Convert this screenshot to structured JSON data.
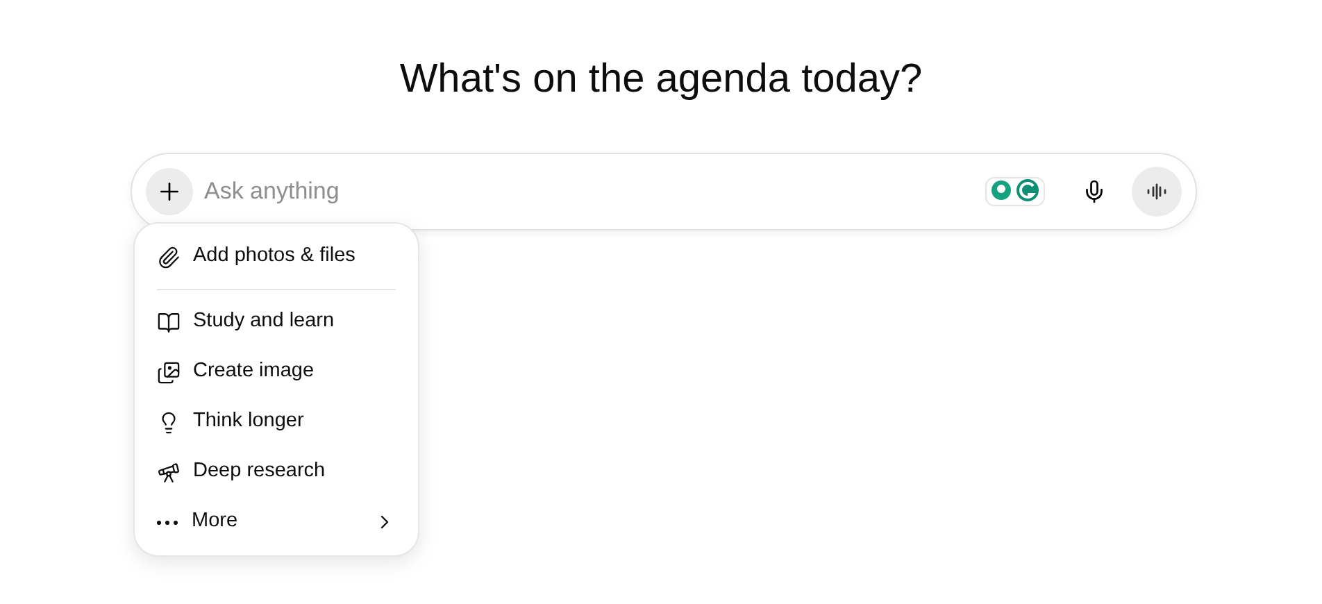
{
  "heading": "What's on the agenda today?",
  "composer": {
    "placeholder": "Ask anything"
  },
  "menu": {
    "groups": [
      [
        {
          "label": "Add photos & files",
          "kind": "action"
        }
      ],
      [
        {
          "label": "Study and learn",
          "kind": "action"
        },
        {
          "label": "Create image",
          "kind": "action"
        },
        {
          "label": "Think longer",
          "kind": "action"
        },
        {
          "label": "Deep research",
          "kind": "action"
        },
        {
          "label": "More",
          "kind": "submenu"
        }
      ]
    ]
  }
}
